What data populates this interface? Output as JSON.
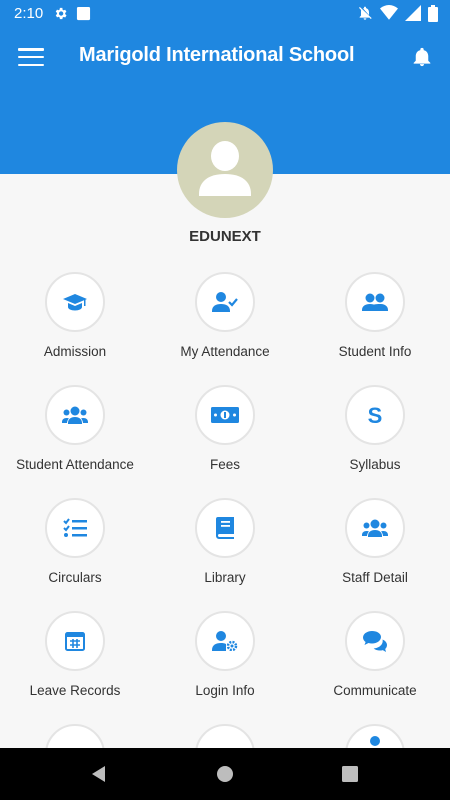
{
  "status_bar": {
    "time": "2:10",
    "left_icons": [
      "gear-icon",
      "square-notification-icon"
    ],
    "right_icons": [
      "mute-notification-icon",
      "wifi-icon",
      "signal-icon",
      "battery-icon"
    ]
  },
  "app_bar": {
    "title": "Marigold International School",
    "menu_icon": "hamburger-menu-icon",
    "notification_icon": "bell-icon",
    "color": "#1f87e0"
  },
  "profile": {
    "name": "EDUNEXT",
    "avatar_icon": "user-placeholder-icon",
    "avatar_bg": "#d4d5b8"
  },
  "menu": {
    "accent": "#1f87e0",
    "items": [
      {
        "label": "Admission",
        "icon": "graduation-cap-icon"
      },
      {
        "label": "My Attendance",
        "icon": "user-check-icon"
      },
      {
        "label": "Student Info",
        "icon": "users-icon"
      },
      {
        "label": "Student Attendance",
        "icon": "group-icon"
      },
      {
        "label": "Fees",
        "icon": "money-bill-icon"
      },
      {
        "label": "Syllabus",
        "icon": "letter-s-icon"
      },
      {
        "label": "Circulars",
        "icon": "checklist-icon"
      },
      {
        "label": "Library",
        "icon": "book-icon"
      },
      {
        "label": "Staff Detail",
        "icon": "group-icon"
      },
      {
        "label": "Leave Records",
        "icon": "calendar-icon"
      },
      {
        "label": "Login Info",
        "icon": "user-cog-icon"
      },
      {
        "label": "Communicate",
        "icon": "chat-bubbles-icon"
      }
    ]
  },
  "nav_bar": {
    "buttons": [
      "back-icon",
      "home-icon",
      "recents-icon"
    ]
  }
}
